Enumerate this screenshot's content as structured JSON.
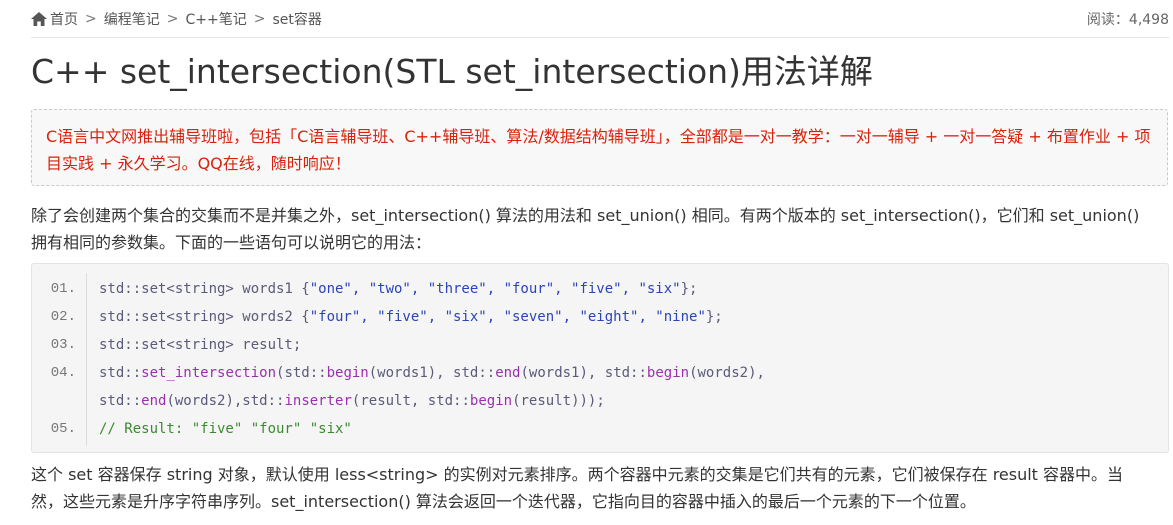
{
  "breadcrumb": {
    "home": "首页",
    "separator": ">",
    "items": [
      "编程笔记",
      "C++笔记",
      "set容器"
    ]
  },
  "reads": "阅读：4,498",
  "title": "C++ set_intersection(STL set_intersection)用法详解",
  "notice": "C语言中文网推出辅导班啦，包括「C语言辅导班、C++辅导班、算法/数据结构辅导班」，全部都是一对一教学：一对一辅导 + 一对一答疑 + 布置作业 + 项目实践 + 永久学习。QQ在线，随时响应！",
  "intro": "除了会创建两个集合的交集而不是并集之外，set_intersection() 算法的用法和 set_union() 相同。有两个版本的 set_intersection()，它们和 set_union() 拥有相同的参数集。下面的一些语句可以说明它的用法：",
  "code": {
    "lines": [
      {
        "num": "01.",
        "parts": [
          [
            "def",
            "std::set<string> words1 {"
          ],
          [
            "str",
            "\"one\", \"two\", \"three\", \"four\", \"five\", \"six\""
          ],
          [
            "def",
            "};"
          ]
        ]
      },
      {
        "num": "02.",
        "parts": [
          [
            "def",
            "std::set<string> words2 {"
          ],
          [
            "str",
            "\"four\", \"five\", \"six\", \"seven\", \"eight\", \"nine\""
          ],
          [
            "def",
            "};"
          ]
        ]
      },
      {
        "num": "03.",
        "parts": [
          [
            "def",
            "std::set<string> result;"
          ]
        ]
      },
      {
        "num": "04.",
        "parts": [
          [
            "def",
            "std::"
          ],
          [
            "fn",
            "set_intersection"
          ],
          [
            "def",
            "(std::"
          ],
          [
            "fn",
            "begin"
          ],
          [
            "def",
            "(words1), std::"
          ],
          [
            "fn",
            "end"
          ],
          [
            "def",
            "(words1), std::"
          ],
          [
            "fn",
            "begin"
          ],
          [
            "def",
            "(words2),"
          ]
        ]
      },
      {
        "num": "",
        "parts": [
          [
            "def",
            "std::"
          ],
          [
            "fn",
            "end"
          ],
          [
            "def",
            "(words2),std::"
          ],
          [
            "fn",
            "inserter"
          ],
          [
            "def",
            "(result, std::"
          ],
          [
            "fn",
            "begin"
          ],
          [
            "def",
            "(result)));"
          ]
        ]
      },
      {
        "num": "05.",
        "parts": [
          [
            "com",
            "// Result: \"five\" \"four\" \"six\""
          ]
        ]
      }
    ]
  },
  "outro": "这个 set 容器保存 string 对象，默认使用 less<string> 的实例对元素排序。两个容器中元素的交集是它们共有的元素，它们被保存在 result 容器中。当然，这些元素是升序字符串序列。set_intersection() 算法会返回一个迭代器，它指向目的容器中插入的最后一个元素的下一个位置。"
}
